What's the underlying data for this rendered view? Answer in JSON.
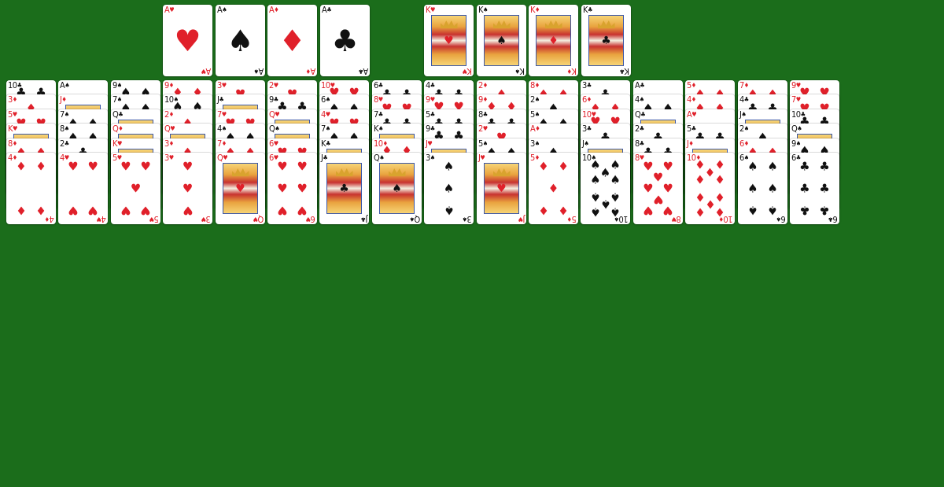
{
  "colors": {
    "table": "#1b6d1b",
    "card": "#ffffff",
    "red": "#e0202a",
    "black": "#111111"
  },
  "foundation_aces": [
    {
      "rank": "A",
      "suit": "♥"
    },
    {
      "rank": "A",
      "suit": "♠"
    },
    {
      "rank": "A",
      "suit": "♦"
    },
    {
      "rank": "A",
      "suit": "♣"
    }
  ],
  "foundation_kings": [
    {
      "rank": "K",
      "suit": "♥"
    },
    {
      "rank": "K",
      "suit": "♠"
    },
    {
      "rank": "K",
      "suit": "♦"
    },
    {
      "rank": "K",
      "suit": "♣"
    }
  ],
  "tableau": [
    {
      "cards": [
        {
          "rank": "10",
          "suit": "♣"
        },
        {
          "rank": "3",
          "suit": "♦"
        },
        {
          "rank": "5",
          "suit": "♥"
        },
        {
          "rank": "K",
          "suit": "♥"
        },
        {
          "rank": "8",
          "suit": "♦"
        },
        {
          "rank": "4",
          "suit": "♦"
        }
      ]
    },
    {
      "cards": [
        {
          "rank": "A",
          "suit": "♠"
        },
        {
          "rank": "J",
          "suit": "♦"
        },
        {
          "rank": "7",
          "suit": "♠"
        },
        {
          "rank": "8",
          "suit": "♠"
        },
        {
          "rank": "2",
          "suit": "♣"
        },
        {
          "rank": "4",
          "suit": "♥"
        }
      ]
    },
    {
      "cards": [
        {
          "rank": "9",
          "suit": "♠"
        },
        {
          "rank": "7",
          "suit": "♠"
        },
        {
          "rank": "Q",
          "suit": "♣"
        },
        {
          "rank": "Q",
          "suit": "♦"
        },
        {
          "rank": "K",
          "suit": "♥"
        },
        {
          "rank": "5",
          "suit": "♥"
        }
      ]
    },
    {
      "cards": [
        {
          "rank": "9",
          "suit": "♦"
        },
        {
          "rank": "10",
          "suit": "♠"
        },
        {
          "rank": "2",
          "suit": "♦"
        },
        {
          "rank": "Q",
          "suit": "♥"
        },
        {
          "rank": "3",
          "suit": "♦"
        },
        {
          "rank": "3",
          "suit": "♥"
        }
      ]
    },
    {
      "cards": [
        {
          "rank": "3",
          "suit": "♥"
        },
        {
          "rank": "J",
          "suit": "♣"
        },
        {
          "rank": "7",
          "suit": "♥"
        },
        {
          "rank": "4",
          "suit": "♠"
        },
        {
          "rank": "7",
          "suit": "♦"
        },
        {
          "rank": "Q",
          "suit": "♥"
        }
      ]
    },
    {
      "cards": [
        {
          "rank": "2",
          "suit": "♥"
        },
        {
          "rank": "9",
          "suit": "♣"
        },
        {
          "rank": "Q",
          "suit": "♥"
        },
        {
          "rank": "Q",
          "suit": "♠"
        },
        {
          "rank": "6",
          "suit": "♥"
        },
        {
          "rank": "6",
          "suit": "♥"
        }
      ]
    },
    {
      "cards": [
        {
          "rank": "10",
          "suit": "♥"
        },
        {
          "rank": "6",
          "suit": "♠"
        },
        {
          "rank": "4",
          "suit": "♥"
        },
        {
          "rank": "7",
          "suit": "♠"
        },
        {
          "rank": "K",
          "suit": "♣"
        },
        {
          "rank": "J",
          "suit": "♣"
        }
      ]
    },
    {
      "cards": [
        {
          "rank": "6",
          "suit": "♣"
        },
        {
          "rank": "8",
          "suit": "♥"
        },
        {
          "rank": "7",
          "suit": "♣"
        },
        {
          "rank": "K",
          "suit": "♠"
        },
        {
          "rank": "10",
          "suit": "♦"
        },
        {
          "rank": "Q",
          "suit": "♠"
        }
      ]
    },
    {
      "cards": [
        {
          "rank": "4",
          "suit": "♣"
        },
        {
          "rank": "9",
          "suit": "♥"
        },
        {
          "rank": "5",
          "suit": "♣"
        },
        {
          "rank": "9",
          "suit": "♣"
        },
        {
          "rank": "J",
          "suit": "♥"
        },
        {
          "rank": "3",
          "suit": "♠"
        }
      ]
    },
    {
      "cards": [
        {
          "rank": "2",
          "suit": "♦"
        },
        {
          "rank": "9",
          "suit": "♦"
        },
        {
          "rank": "8",
          "suit": "♣"
        },
        {
          "rank": "2",
          "suit": "♥"
        },
        {
          "rank": "5",
          "suit": "♠"
        },
        {
          "rank": "J",
          "suit": "♥"
        }
      ]
    },
    {
      "cards": [
        {
          "rank": "8",
          "suit": "♦"
        },
        {
          "rank": "2",
          "suit": "♠"
        },
        {
          "rank": "5",
          "suit": "♠"
        },
        {
          "rank": "A",
          "suit": "♦"
        },
        {
          "rank": "3",
          "suit": "♠"
        },
        {
          "rank": "5",
          "suit": "♦"
        }
      ]
    },
    {
      "cards": [
        {
          "rank": "3",
          "suit": "♣"
        },
        {
          "rank": "6",
          "suit": "♦"
        },
        {
          "rank": "10",
          "suit": "♥"
        },
        {
          "rank": "3",
          "suit": "♣"
        },
        {
          "rank": "J",
          "suit": "♠"
        },
        {
          "rank": "10",
          "suit": "♠"
        }
      ]
    },
    {
      "cards": [
        {
          "rank": "A",
          "suit": "♣"
        },
        {
          "rank": "4",
          "suit": "♠"
        },
        {
          "rank": "Q",
          "suit": "♣"
        },
        {
          "rank": "2",
          "suit": "♣"
        },
        {
          "rank": "8",
          "suit": "♣"
        },
        {
          "rank": "8",
          "suit": "♥"
        }
      ]
    },
    {
      "cards": [
        {
          "rank": "5",
          "suit": "♦"
        },
        {
          "rank": "4",
          "suit": "♦"
        },
        {
          "rank": "A",
          "suit": "♥"
        },
        {
          "rank": "5",
          "suit": "♣"
        },
        {
          "rank": "J",
          "suit": "♦"
        },
        {
          "rank": "10",
          "suit": "♦"
        }
      ]
    },
    {
      "cards": [
        {
          "rank": "7",
          "suit": "♦"
        },
        {
          "rank": "4",
          "suit": "♣"
        },
        {
          "rank": "J",
          "suit": "♠"
        },
        {
          "rank": "2",
          "suit": "♠"
        },
        {
          "rank": "6",
          "suit": "♦"
        },
        {
          "rank": "6",
          "suit": "♠"
        }
      ]
    },
    {
      "cards": [
        {
          "rank": "9",
          "suit": "♥"
        },
        {
          "rank": "7",
          "suit": "♥"
        },
        {
          "rank": "10",
          "suit": "♣"
        },
        {
          "rank": "Q",
          "suit": "♠"
        },
        {
          "rank": "9",
          "suit": "♠"
        },
        {
          "rank": "6",
          "suit": "♣"
        }
      ]
    }
  ]
}
